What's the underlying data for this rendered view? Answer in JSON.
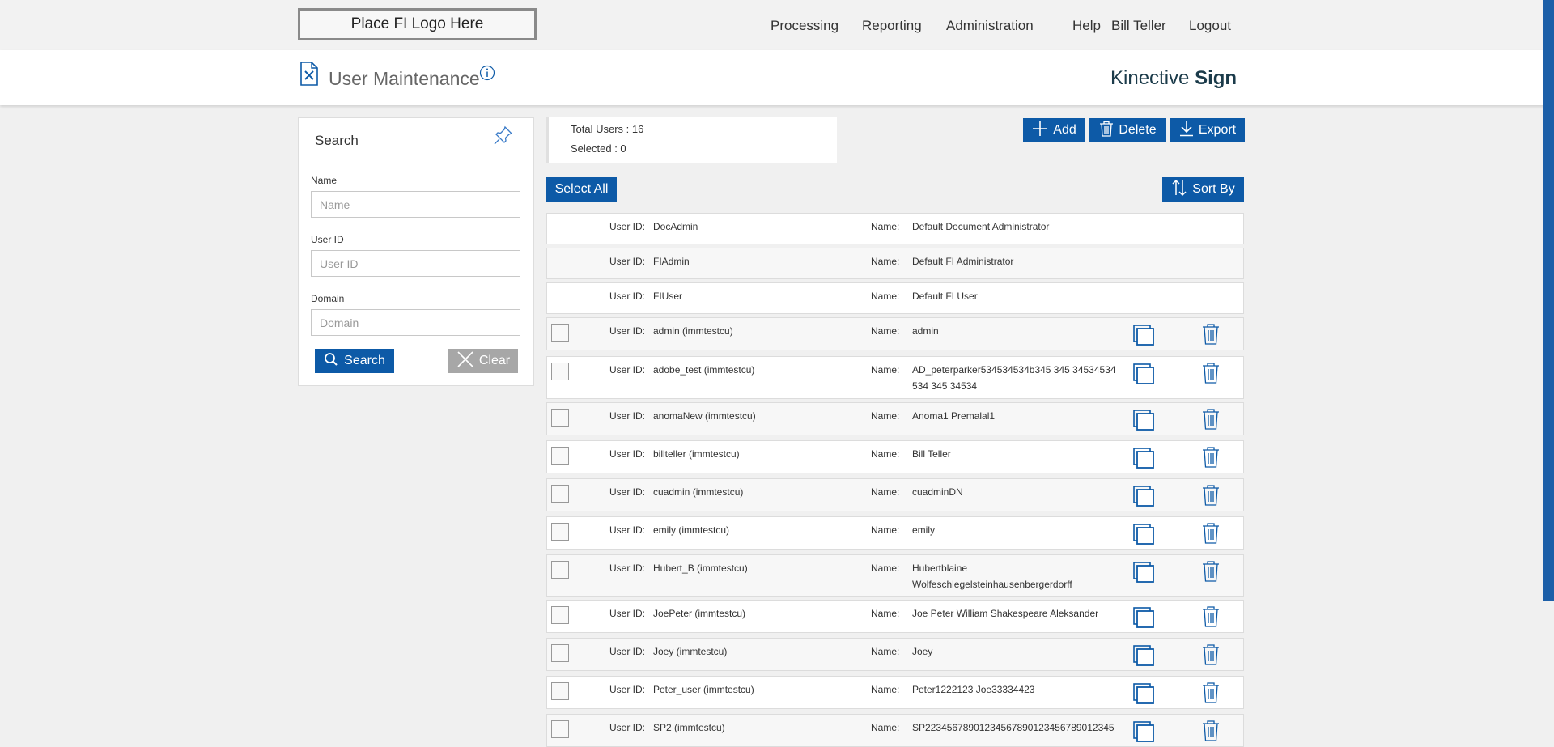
{
  "top_nav": {
    "logo_text": "Place FI Logo Here",
    "items": [
      "Processing",
      "Reporting",
      "Administration",
      "Help",
      "Bill Teller",
      "Logout"
    ]
  },
  "header": {
    "page_title": "User Maintenance",
    "brand_light": "Kinective ",
    "brand_bold": "Sign"
  },
  "search": {
    "title": "Search",
    "name_label": "Name",
    "name_placeholder": "Name",
    "userid_label": "User ID",
    "userid_placeholder": "User ID",
    "domain_label": "Domain",
    "domain_placeholder": "Domain",
    "search_button": "Search",
    "clear_button": "Clear"
  },
  "summary": {
    "total_users": "Total Users : 16",
    "selected": "Selected : 0"
  },
  "toolbar": {
    "add": "Add",
    "delete": "Delete",
    "export": "Export",
    "select_all": "Select All",
    "sort_by": "Sort By"
  },
  "row_labels": {
    "user_id": "User ID:",
    "name": "Name:"
  },
  "users": [
    {
      "user_id": "DocAdmin",
      "name": "Default Document Administrator"
    },
    {
      "user_id": "FIAdmin",
      "name": "Default FI Administrator"
    },
    {
      "user_id": "FIUser",
      "name": "Default FI User"
    },
    {
      "user_id": "admin (immtestcu)",
      "name": "admin"
    },
    {
      "user_id": "adobe_test (immtestcu)",
      "name": "AD_peterparker534534534b345 345 34534534 534 345 34534"
    },
    {
      "user_id": "anomaNew (immtestcu)",
      "name": "Anoma1 Premalal1"
    },
    {
      "user_id": "billteller (immtestcu)",
      "name": "Bill Teller"
    },
    {
      "user_id": "cuadmin (immtestcu)",
      "name": "cuadminDN"
    },
    {
      "user_id": "emily (immtestcu)",
      "name": "emily"
    },
    {
      "user_id": "Hubert_B (immtestcu)",
      "name": "Hubertblaine Wolfeschlegelsteinhausenbergerdorff"
    },
    {
      "user_id": "JoePeter (immtestcu)",
      "name": "Joe Peter William Shakespeare Aleksander"
    },
    {
      "user_id": "Joey (immtestcu)",
      "name": "Joey"
    },
    {
      "user_id": "Peter_user (immtestcu)",
      "name": "Peter1222123 Joe33334423"
    },
    {
      "user_id": "SP2 (immtestcu)",
      "name": "SP22345678901234567890123456789012345"
    }
  ],
  "colors": {
    "accent": "#0d5aa7",
    "clear_button": "#a7a7a7",
    "background": "#f0f0f0"
  }
}
